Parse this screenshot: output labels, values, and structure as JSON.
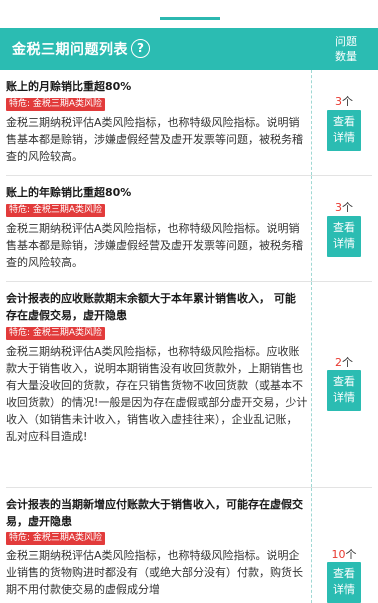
{
  "header": {
    "title": "金税三期问题列表",
    "help_symbol": "?",
    "count_label_line1": "问题",
    "count_label_line2": "数量"
  },
  "items": [
    {
      "title": "账上的月赊销比重超80%",
      "tag": "特危: 金税三期A类风险",
      "desc": "金税三期纳税评估A类风险指标，也称特级风险指标。说明销售基本都是赊销，涉嫌虚假经营及虚开发票等问题，被税务稽查的风险较高。",
      "count": "3",
      "unit": "个",
      "button_line1": "查看",
      "button_line2": "详情"
    },
    {
      "title": "账上的年赊销比重超80%",
      "tag": "特危: 金税三期A类风险",
      "desc": "金税三期纳税评估A类风险指标，也称特级风险指标。说明销售基本都是赊销，涉嫌虚假经营及虚开发票等问题，被税务稽查的风险较高。",
      "count": "3",
      "unit": "个",
      "button_line1": "查看",
      "button_line2": "详情"
    },
    {
      "title": "会计报表的应收账款期末余额大于本年累计销售收入， 可能存在虚假交易，虚开隐患",
      "tag": "特危: 金税三期A类风险",
      "desc": "金税三期纳税评估A类风险指标，也称特级风险指标。应收账款大于销售收入，说明本期销售没有收回货款外，上期销售也有大量没收回的货款，存在只销售货物不收回货款（或基本不收回货款）的情况!一般是因为存在虚假或部分虚开交易，少计收入（如销售未计收入，销售收入虚挂往来），企业乱记账，乱对应科目造成!",
      "count": "2",
      "unit": "个",
      "button_line1": "查看",
      "button_line2": "详情"
    },
    {
      "title": "会计报表的当期新增应付账款大于销售收入，可能存在虚假交易，虚开隐患",
      "tag": "特危: 金税三期A类风险",
      "desc": "金税三期纳税评估A类风险指标，也称特级风险指标。说明企业销售的货物购进时都没有（或绝大部分没有）付款，购货长期不用付款使交易的虚假成分增",
      "count": "10",
      "unit": "个",
      "button_line1": "查看",
      "button_line2": "详情"
    }
  ]
}
